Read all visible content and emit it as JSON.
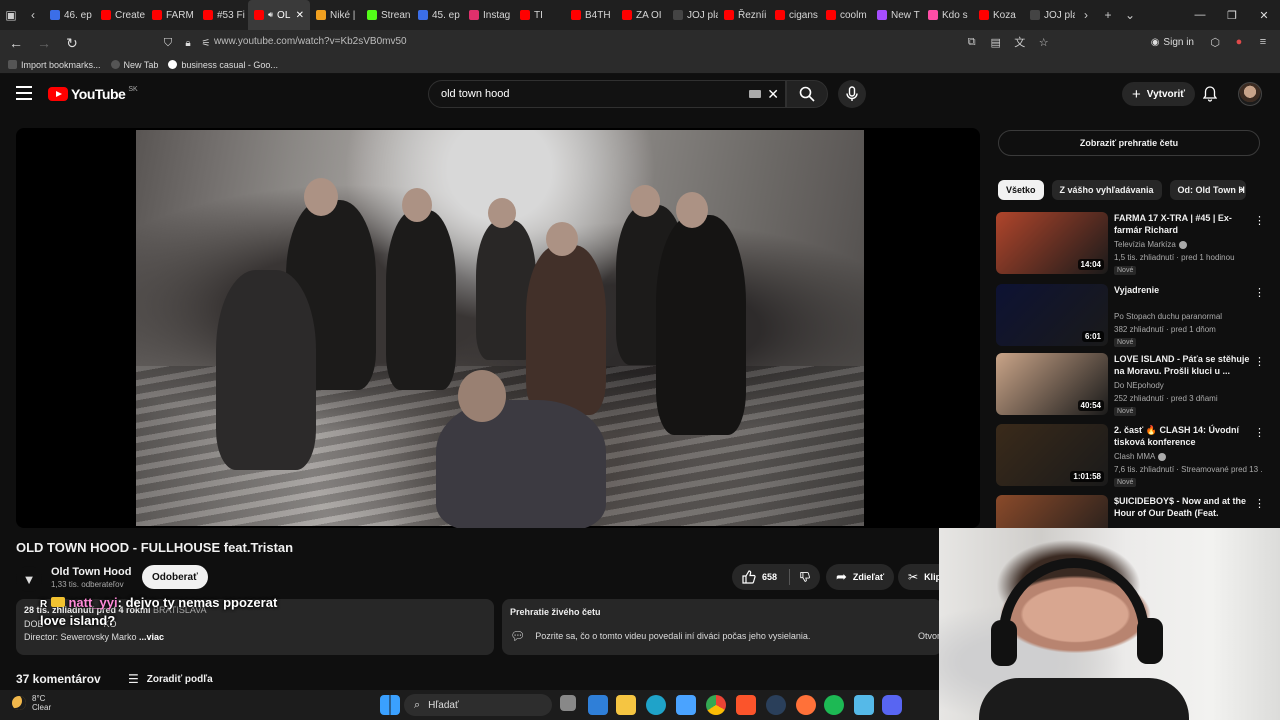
{
  "browser": {
    "tabs": [
      {
        "label": "46. ep",
        "color": "#3b6ee8"
      },
      {
        "label": "Create",
        "color": "#ff0000"
      },
      {
        "label": "FARM",
        "color": "#ff0000"
      },
      {
        "label": "#53 Fi",
        "color": "#ff0000"
      },
      {
        "label": "OL",
        "color": "#ff0000",
        "active": true
      },
      {
        "label": "Niké |",
        "color": "#f0a020"
      },
      {
        "label": "Strean",
        "color": "#53fc18"
      },
      {
        "label": "45. ep",
        "color": "#3b6ee8"
      },
      {
        "label": "Instag",
        "color": "#e1306c"
      },
      {
        "label": "TI",
        "color": "#ff0000"
      },
      {
        "label": "B4TH",
        "color": "#ff0000"
      },
      {
        "label": "ZA OI",
        "color": "#ff0000"
      },
      {
        "label": "JOJ play",
        "color": "#444444"
      },
      {
        "label": "Řezníi",
        "color": "#ff0000"
      },
      {
        "label": "cigans",
        "color": "#ff0000"
      },
      {
        "label": "coolm",
        "color": "#ff0000"
      },
      {
        "label": "New T",
        "color": "#a64dff"
      },
      {
        "label": "Kdo s",
        "color": "#ff4da6"
      },
      {
        "label": "Koza",
        "color": "#ff0000"
      },
      {
        "label": "JOJ play",
        "color": "#444444"
      }
    ],
    "url": "www.youtube.com/watch?v=Kb2sVB0mv50",
    "sign_in": "Sign in",
    "bookmarks": [
      "Import bookmarks...",
      "New Tab",
      "business casual - Goo..."
    ]
  },
  "youtube": {
    "logo_text": "YouTube",
    "country_code": "SK",
    "search_value": "old town hood",
    "create_label": "Vytvoriť"
  },
  "video": {
    "title": "OLD TOWN HOOD - FULLHOUSE feat.Tristan",
    "channel": "Old Town Hood",
    "subscribers": "1,33 tis. odberateľov",
    "subscribe_label": "Odoberať",
    "likes": "658",
    "share_label": "Zdieľať",
    "clip_label": "Klip",
    "desc_views": "28 tis. zhliadnutí  pred 4 rokmi",
    "desc_place": "BRATISLAVA",
    "desc_line2": "DOB",
    "desc_line2b": "KO",
    "desc_line3": "Director: Sewerovsky Marko",
    "desc_more": "...viac",
    "overlay_prefix": "R",
    "overlay_user": "natt_yyi",
    "overlay_line1": ": dejvo ty nemas ppozerat",
    "overlay_line2": "love island?",
    "livechat_title": "Prehratie živého četu",
    "livechat_text": "Pozrite sa, čo o tomto videu povedali iní diváci počas jeho vysielania.",
    "livechat_open": "Otvor",
    "comments_count": "37 komentárov",
    "sort_label": "Zoradiť podľa"
  },
  "sidebar": {
    "show_chat": "Zobraziť prehratie četu",
    "chips": [
      "Všetko",
      "Z vášho vyhľadávania",
      "Od: Old Town H"
    ],
    "recommendations": [
      {
        "title": "FARMA 17 X-TRA | #45 | Ex-farmár Richard",
        "channel": "Televízia Markíza",
        "verified": true,
        "views": "1,5 tis. zhliadnutí · pred 1 hodinou",
        "duration": "14:04",
        "badge": "Nové",
        "thumb_color": "#b0452b"
      },
      {
        "title": "Vyjadrenie",
        "channel": "Po Stopach duchu paranormal",
        "verified": false,
        "views": "382 zhliadnutí · pred 1 dňom",
        "duration": "6:01",
        "badge": "Nové",
        "thumb_color": "#0d1233"
      },
      {
        "title": "LOVE ISLAND - Páťa se stěhuje na Moravu. Prošli kluci u ...",
        "channel": "Do NEpohody",
        "verified": false,
        "views": "252 zhliadnutí · pred 3 dňami",
        "duration": "40:54",
        "badge": "Nové",
        "thumb_color": "#c9a488"
      },
      {
        "title": "2. časť 🔥 CLASH 14: Úvodní tisková konference",
        "channel": "Clash MMA",
        "verified": true,
        "views": "7,6 tis. zhliadnutí · Streamované pred 13 ...",
        "duration": "1:01:58",
        "badge": "Nové",
        "thumb_color": "#3a2a1a"
      },
      {
        "title": "$UICIDEBOY$ - Now and at the Hour of Our Death (Feat. Bones)",
        "channel": "",
        "verified": false,
        "views": "",
        "duration": "",
        "badge": "",
        "thumb_color": "#8a4a2a"
      }
    ]
  },
  "taskbar": {
    "temp": "8°C",
    "condition": "Clear",
    "search_placeholder": "Hľadať"
  }
}
